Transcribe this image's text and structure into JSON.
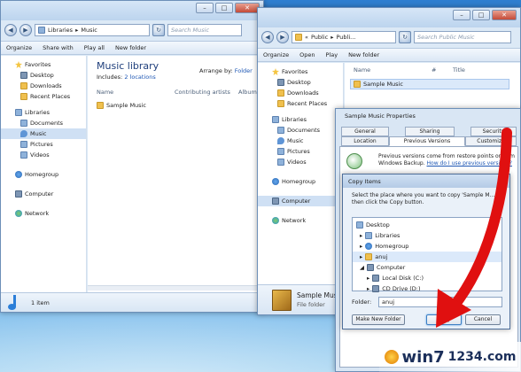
{
  "left_window": {
    "address": [
      "Libraries",
      "Music"
    ],
    "search_placeholder": "Search Music",
    "toolbar": [
      "Organize",
      "Share with",
      "Play all",
      "New folder"
    ],
    "nav": [
      "Favorites",
      "Desktop",
      "Downloads",
      "Recent Places",
      "Libraries",
      "Documents",
      "Music",
      "Pictures",
      "Videos",
      "Homegroup",
      "Computer",
      "Network"
    ],
    "library_title": "Music library",
    "includes_label": "Includes:",
    "includes_link": "2 locations",
    "arrange_label": "Arrange by:",
    "arrange_value": "Folder",
    "columns": [
      "Name",
      "Contributing artists",
      "Album"
    ],
    "items": [
      "Sample Music"
    ],
    "status": "1 item"
  },
  "right_window": {
    "address": [
      "«",
      "Public",
      "Publi..."
    ],
    "search_placeholder": "Search Public Music",
    "toolbar": [
      "Organize",
      "Open",
      "Play",
      "New folder"
    ],
    "nav": [
      "Favorites",
      "Desktop",
      "Downloads",
      "Recent Places",
      "Libraries",
      "Documents",
      "Music",
      "Pictures",
      "Videos",
      "Homegroup",
      "Computer",
      "Network"
    ],
    "columns": [
      "Name",
      "#",
      "Title"
    ],
    "items": [
      "Sample Music"
    ],
    "status_name": "Sample Mus",
    "status_type": "File folder"
  },
  "properties_dialog": {
    "title": "Sample Music Properties",
    "tabs_row1": [
      "General",
      "Sharing",
      "Security"
    ],
    "tabs_row2": [
      "Location",
      "Previous Versions",
      "Customize"
    ],
    "info_text": "Previous versions come from restore points or from Windows Backup.",
    "info_link": "How do I use previous versions?"
  },
  "copy_dialog": {
    "title": "Copy Items",
    "instruction": "Select the place where you want to copy 'Sample M... then click the Copy button.",
    "tree": [
      "Desktop",
      "Libraries",
      "Homegroup",
      "anuj",
      "Computer",
      "Local Disk (C:)",
      "CD Drive (D:)"
    ],
    "folder_label": "Folder:",
    "folder_value": "anuj",
    "buttons": [
      "Make New Folder",
      "Copy",
      "Cancel"
    ]
  },
  "watermark": {
    "text": "win7",
    "domain": "1234.com"
  }
}
